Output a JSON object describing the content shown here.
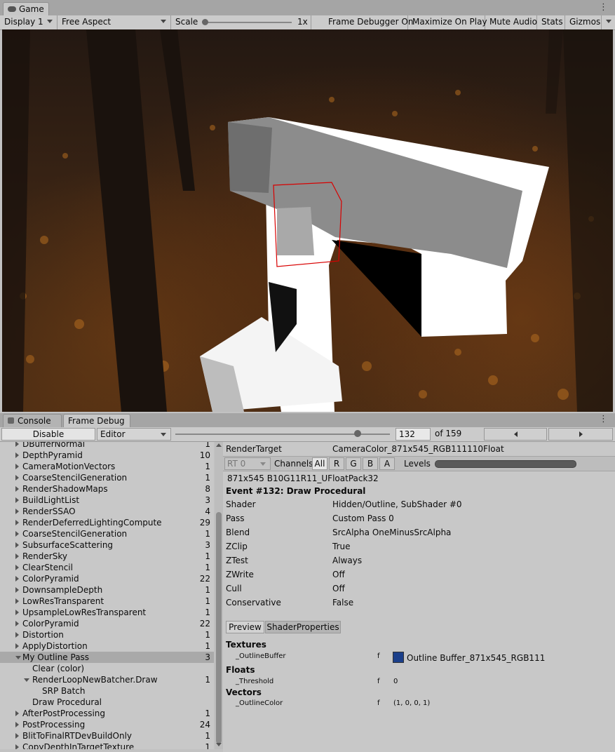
{
  "top_tabs": {
    "game_label": "Game"
  },
  "game_toolbar": {
    "display": "Display 1",
    "aspect": "Free Aspect",
    "scale_label": "Scale",
    "scale_value": "1x",
    "frame_debugger": "Frame Debugger On",
    "maximize": "Maximize On Play",
    "mute": "Mute Audio",
    "stats": "Stats",
    "gizmos": "Gizmos"
  },
  "bottom_tabs": {
    "console": "Console",
    "frame_debug": "Frame Debug"
  },
  "frame_debug_bar": {
    "disable": "Disable",
    "target": "Editor",
    "event_index": "132",
    "event_total": "of 159",
    "slider_position": 0.85
  },
  "events": [
    {
      "label": "DBufferNormal",
      "count": "1",
      "depth": 1,
      "arrow": "right"
    },
    {
      "label": "DepthPyramid",
      "count": "10",
      "depth": 1,
      "arrow": "right"
    },
    {
      "label": "CameraMotionVectors",
      "count": "1",
      "depth": 1,
      "arrow": "right"
    },
    {
      "label": "CoarseStencilGeneration",
      "count": "1",
      "depth": 1,
      "arrow": "right"
    },
    {
      "label": "RenderShadowMaps",
      "count": "8",
      "depth": 1,
      "arrow": "right"
    },
    {
      "label": "BuildLightList",
      "count": "3",
      "depth": 1,
      "arrow": "right"
    },
    {
      "label": "RenderSSAO",
      "count": "4",
      "depth": 1,
      "arrow": "right"
    },
    {
      "label": "RenderDeferredLightingCompute",
      "count": "29",
      "depth": 1,
      "arrow": "right"
    },
    {
      "label": "CoarseStencilGeneration",
      "count": "1",
      "depth": 1,
      "arrow": "right"
    },
    {
      "label": "SubsurfaceScattering",
      "count": "3",
      "depth": 1,
      "arrow": "right"
    },
    {
      "label": "RenderSky",
      "count": "1",
      "depth": 1,
      "arrow": "right"
    },
    {
      "label": "ClearStencil",
      "count": "1",
      "depth": 1,
      "arrow": "right"
    },
    {
      "label": "ColorPyramid",
      "count": "22",
      "depth": 1,
      "arrow": "right"
    },
    {
      "label": "DownsampleDepth",
      "count": "1",
      "depth": 1,
      "arrow": "right"
    },
    {
      "label": "LowResTransparent",
      "count": "1",
      "depth": 1,
      "arrow": "right"
    },
    {
      "label": "UpsampleLowResTransparent",
      "count": "1",
      "depth": 1,
      "arrow": "right"
    },
    {
      "label": "ColorPyramid",
      "count": "22",
      "depth": 1,
      "arrow": "right"
    },
    {
      "label": "Distortion",
      "count": "1",
      "depth": 1,
      "arrow": "right"
    },
    {
      "label": "ApplyDistortion",
      "count": "1",
      "depth": 1,
      "arrow": "right"
    },
    {
      "label": "My Outline Pass",
      "count": "3",
      "depth": 1,
      "arrow": "down",
      "selected": true
    },
    {
      "label": "Clear (color)",
      "count": "",
      "depth": 2,
      "arrow": ""
    },
    {
      "label": "RenderLoopNewBatcher.Draw",
      "count": "1",
      "depth": 2,
      "arrow": "down"
    },
    {
      "label": "SRP Batch",
      "count": "",
      "depth": 3,
      "arrow": ""
    },
    {
      "label": "Draw Procedural",
      "count": "",
      "depth": 2,
      "arrow": ""
    },
    {
      "label": "AfterPostProcessing",
      "count": "1",
      "depth": 1,
      "arrow": "right"
    },
    {
      "label": "PostProcessing",
      "count": "24",
      "depth": 1,
      "arrow": "right"
    },
    {
      "label": "BlitToFinalRTDevBuildOnly",
      "count": "1",
      "depth": 1,
      "arrow": "right"
    },
    {
      "label": "CopyDepthInTargetTexture",
      "count": "1",
      "depth": 1,
      "arrow": "right"
    }
  ],
  "detail": {
    "render_target_label": "RenderTarget",
    "render_target_value": "CameraColor_871x545_RGB111110Float",
    "rt_select": "RT 0",
    "channels_label": "Channels",
    "channels": [
      "All",
      "R",
      "G",
      "B",
      "A"
    ],
    "levels_label": "Levels",
    "format": "871x545 B10G11R11_UFloatPack32",
    "event_title": "Event #132: Draw Procedural",
    "props": [
      {
        "key": "Shader",
        "value": "Hidden/Outline, SubShader #0"
      },
      {
        "key": "Pass",
        "value": "Custom Pass 0"
      },
      {
        "key": "Blend",
        "value": "SrcAlpha OneMinusSrcAlpha"
      },
      {
        "key": "ZClip",
        "value": "True"
      },
      {
        "key": "ZTest",
        "value": "Always"
      },
      {
        "key": "ZWrite",
        "value": "Off"
      },
      {
        "key": "Cull",
        "value": "Off"
      },
      {
        "key": "Conservative",
        "value": "False"
      }
    ],
    "preview_tab": "Preview",
    "shaderprops_tab": "ShaderProperties",
    "textures_header": "Textures",
    "texture_name": "_OutlineBuffer",
    "texture_stage": "f",
    "texture_value": "Outline Buffer_871x545_RGB111",
    "floats_header": "Floats",
    "float_name": "_Threshold",
    "float_stage": "f",
    "float_value": "0",
    "vectors_header": "Vectors",
    "vector_name": "_OutlineColor",
    "vector_stage": "f",
    "vector_value": "(1, 0, 0, 1)"
  }
}
